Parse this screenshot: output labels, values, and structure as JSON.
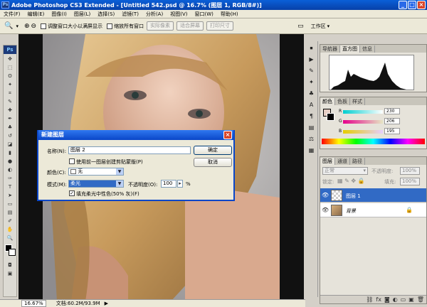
{
  "window": {
    "title": "Adobe Photoshop CS3 Extended - [Untitled 542.psd @ 16.7% (图层 1, RGB/8#)]"
  },
  "menubar": {
    "items": [
      "文件(F)",
      "编辑(E)",
      "图像(I)",
      "图层(L)",
      "选择(S)",
      "滤镜(T)",
      "分析(A)",
      "视图(V)",
      "窗口(W)",
      "帮助(H)"
    ]
  },
  "options": {
    "check_resize": "调整窗口大小以满屏显示",
    "check_all_windows": "缩放所有窗口",
    "btn_actual": "实际像素",
    "btn_fit": "适合屏幕",
    "btn_print": "打印尺寸",
    "workspace": "工作区"
  },
  "dialog": {
    "title": "新建图层",
    "name_label": "名称(N):",
    "name_value": "图层 2",
    "clip_label": "使用前一图层创建剪贴蒙版(P)",
    "color_label": "颜色(C):",
    "color_value": "无",
    "mode_label": "模式(M):",
    "mode_value": "柔光",
    "opacity_label": "不透明度(O):",
    "opacity_value": "100",
    "opacity_unit": "%",
    "fill_label": "填充柔光中性色(50% 灰)(F)",
    "ok": "确定",
    "cancel": "取消"
  },
  "nav_panel": {
    "tabs": [
      "导航器",
      "直方图",
      "信息"
    ]
  },
  "color_panel": {
    "tabs": [
      "颜色",
      "色板",
      "样式"
    ],
    "r": "230",
    "g": "206",
    "b": "195",
    "labels": [
      "R",
      "G",
      "B"
    ]
  },
  "layers_panel": {
    "tabs": [
      "图层",
      "通道",
      "路径"
    ],
    "blend_mode": "正常",
    "opacity_label": "不透明度:",
    "opacity_value": "100%",
    "lock_label": "锁定:",
    "fill_label": "填充:",
    "fill_value": "100%",
    "layers": [
      {
        "name": "图层 1",
        "selected": true
      },
      {
        "name": "背景",
        "selected": false
      }
    ]
  },
  "status": {
    "zoom": "16.67%",
    "doc": "文档:60.2M/93.9M"
  },
  "colors": {
    "accent": "#316ac5",
    "titlebar": "#0a46c8"
  }
}
